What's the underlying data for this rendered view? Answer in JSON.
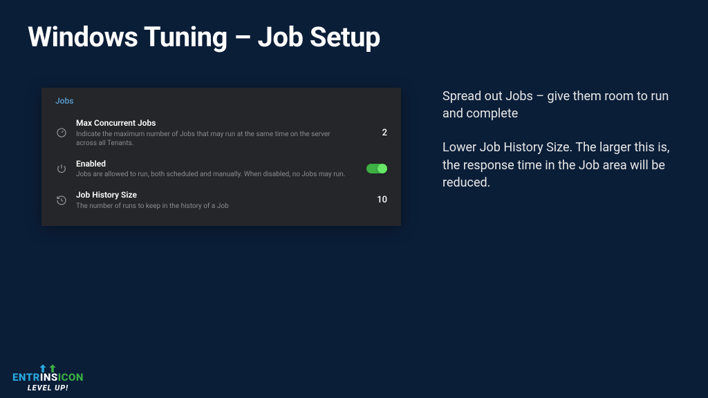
{
  "title": "Windows Tuning – Job Setup",
  "panel": {
    "header": "Jobs",
    "settings": [
      {
        "label": "Max Concurrent Jobs",
        "desc": "Indicate the maximum number of Jobs that may run at the same time on the server across all Tenants.",
        "value": "2"
      },
      {
        "label": "Enabled",
        "desc": "Jobs are allowed to run, both scheduled and manually. When disabled, no Jobs may run."
      },
      {
        "label": "Job History Size",
        "desc": "The number of runs to keep in the history of a Job",
        "value": "10"
      }
    ]
  },
  "bullets": [
    "Spread out Jobs – give them room to run and complete",
    "Lower Job History Size. The larger this is, the response time in the Job area will be reduced."
  ],
  "logo": {
    "line1a": "ENTR",
    "line1b": "INS",
    "line1c": "ICON",
    "line2": "LEVEL UP!"
  },
  "colors": {
    "logo_blue": "#2aa9e0",
    "logo_green": "#3cb043"
  }
}
